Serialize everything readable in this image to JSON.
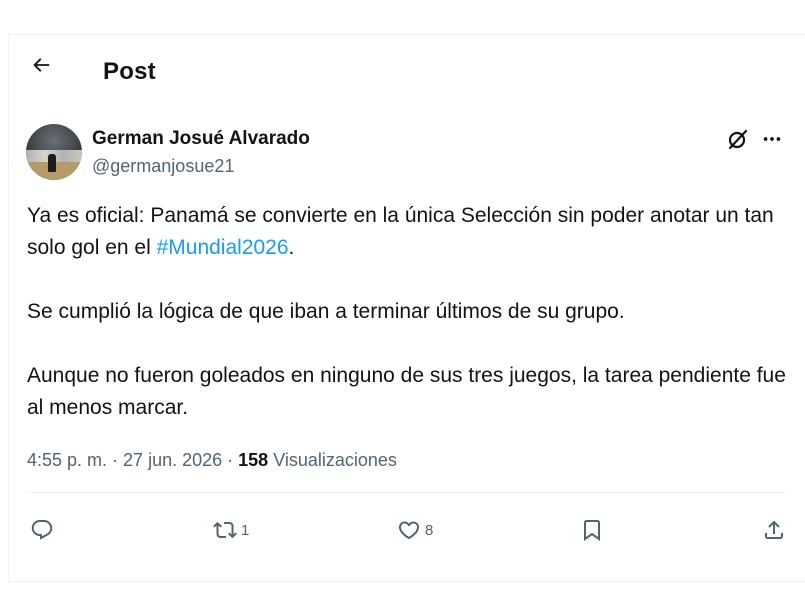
{
  "header": {
    "title": "Post"
  },
  "author": {
    "display_name": "German Josué Alvarado",
    "handle": "@germanjosue21"
  },
  "tweet": {
    "p1_before": "Ya es oficial: Panamá se convierte en la única Selección sin poder anotar un tan solo gol en el ",
    "hashtag": "#Mundial2026",
    "p1_after": ".",
    "p2": "Se cumplió la lógica de que iban a terminar últimos de su grupo.",
    "p3": "Aunque no fueron goleados en ninguno de sus tres juegos, la tarea pendiente fue al menos marcar."
  },
  "meta": {
    "time": "4:55 p. m.",
    "sep1": " · ",
    "date": "27 jun. 2026",
    "sep2": " · ",
    "views_count": "158",
    "views_label": " Visualizaciones"
  },
  "actions": {
    "reply_icon": "reply-icon",
    "retweet_icon": "retweet-icon",
    "retweet_count": "1",
    "like_icon": "heart-icon",
    "like_count": "8",
    "bookmark_icon": "bookmark-icon",
    "share_icon": "share-icon"
  },
  "colors": {
    "text": "#0f1419",
    "secondary": "#536471",
    "link": "#1d9bf0",
    "divider": "#eff3f4"
  }
}
